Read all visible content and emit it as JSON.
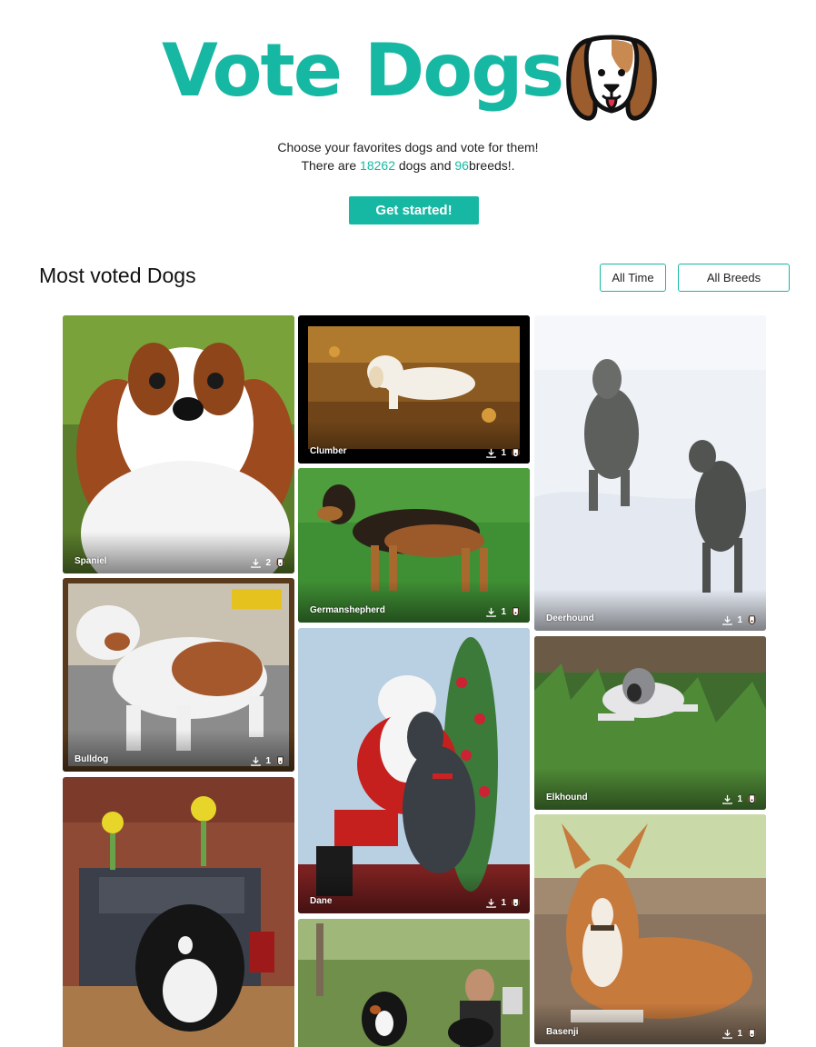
{
  "hero": {
    "title": "Vote Dogs",
    "subtitle": "Choose your favorites dogs and vote for them!",
    "count_prefix": "There are",
    "dogs_count": "18262",
    "count_middle": "dogs and",
    "breeds_count": "96",
    "count_suffix": "breeds!.",
    "cta_label": "Get started!"
  },
  "section": {
    "title": "Most voted Dogs",
    "filter_time": "All Time",
    "filter_breed": "All Breeds"
  },
  "colors": {
    "accent": "#17b8a3"
  },
  "icons": {
    "download": "download-icon",
    "dog": "dog-face-icon"
  },
  "cards": [
    {
      "name": "Spaniel",
      "votes": "2"
    },
    {
      "name": "Bulldog",
      "votes": "1"
    },
    {
      "name": "",
      "votes": ""
    },
    {
      "name": "Clumber",
      "votes": "1"
    },
    {
      "name": "Germanshepherd",
      "votes": "1"
    },
    {
      "name": "Dane",
      "votes": "1"
    },
    {
      "name": "",
      "votes": ""
    },
    {
      "name": "Deerhound",
      "votes": "1"
    },
    {
      "name": "Elkhound",
      "votes": "1"
    },
    {
      "name": "Basenji",
      "votes": "1"
    }
  ]
}
